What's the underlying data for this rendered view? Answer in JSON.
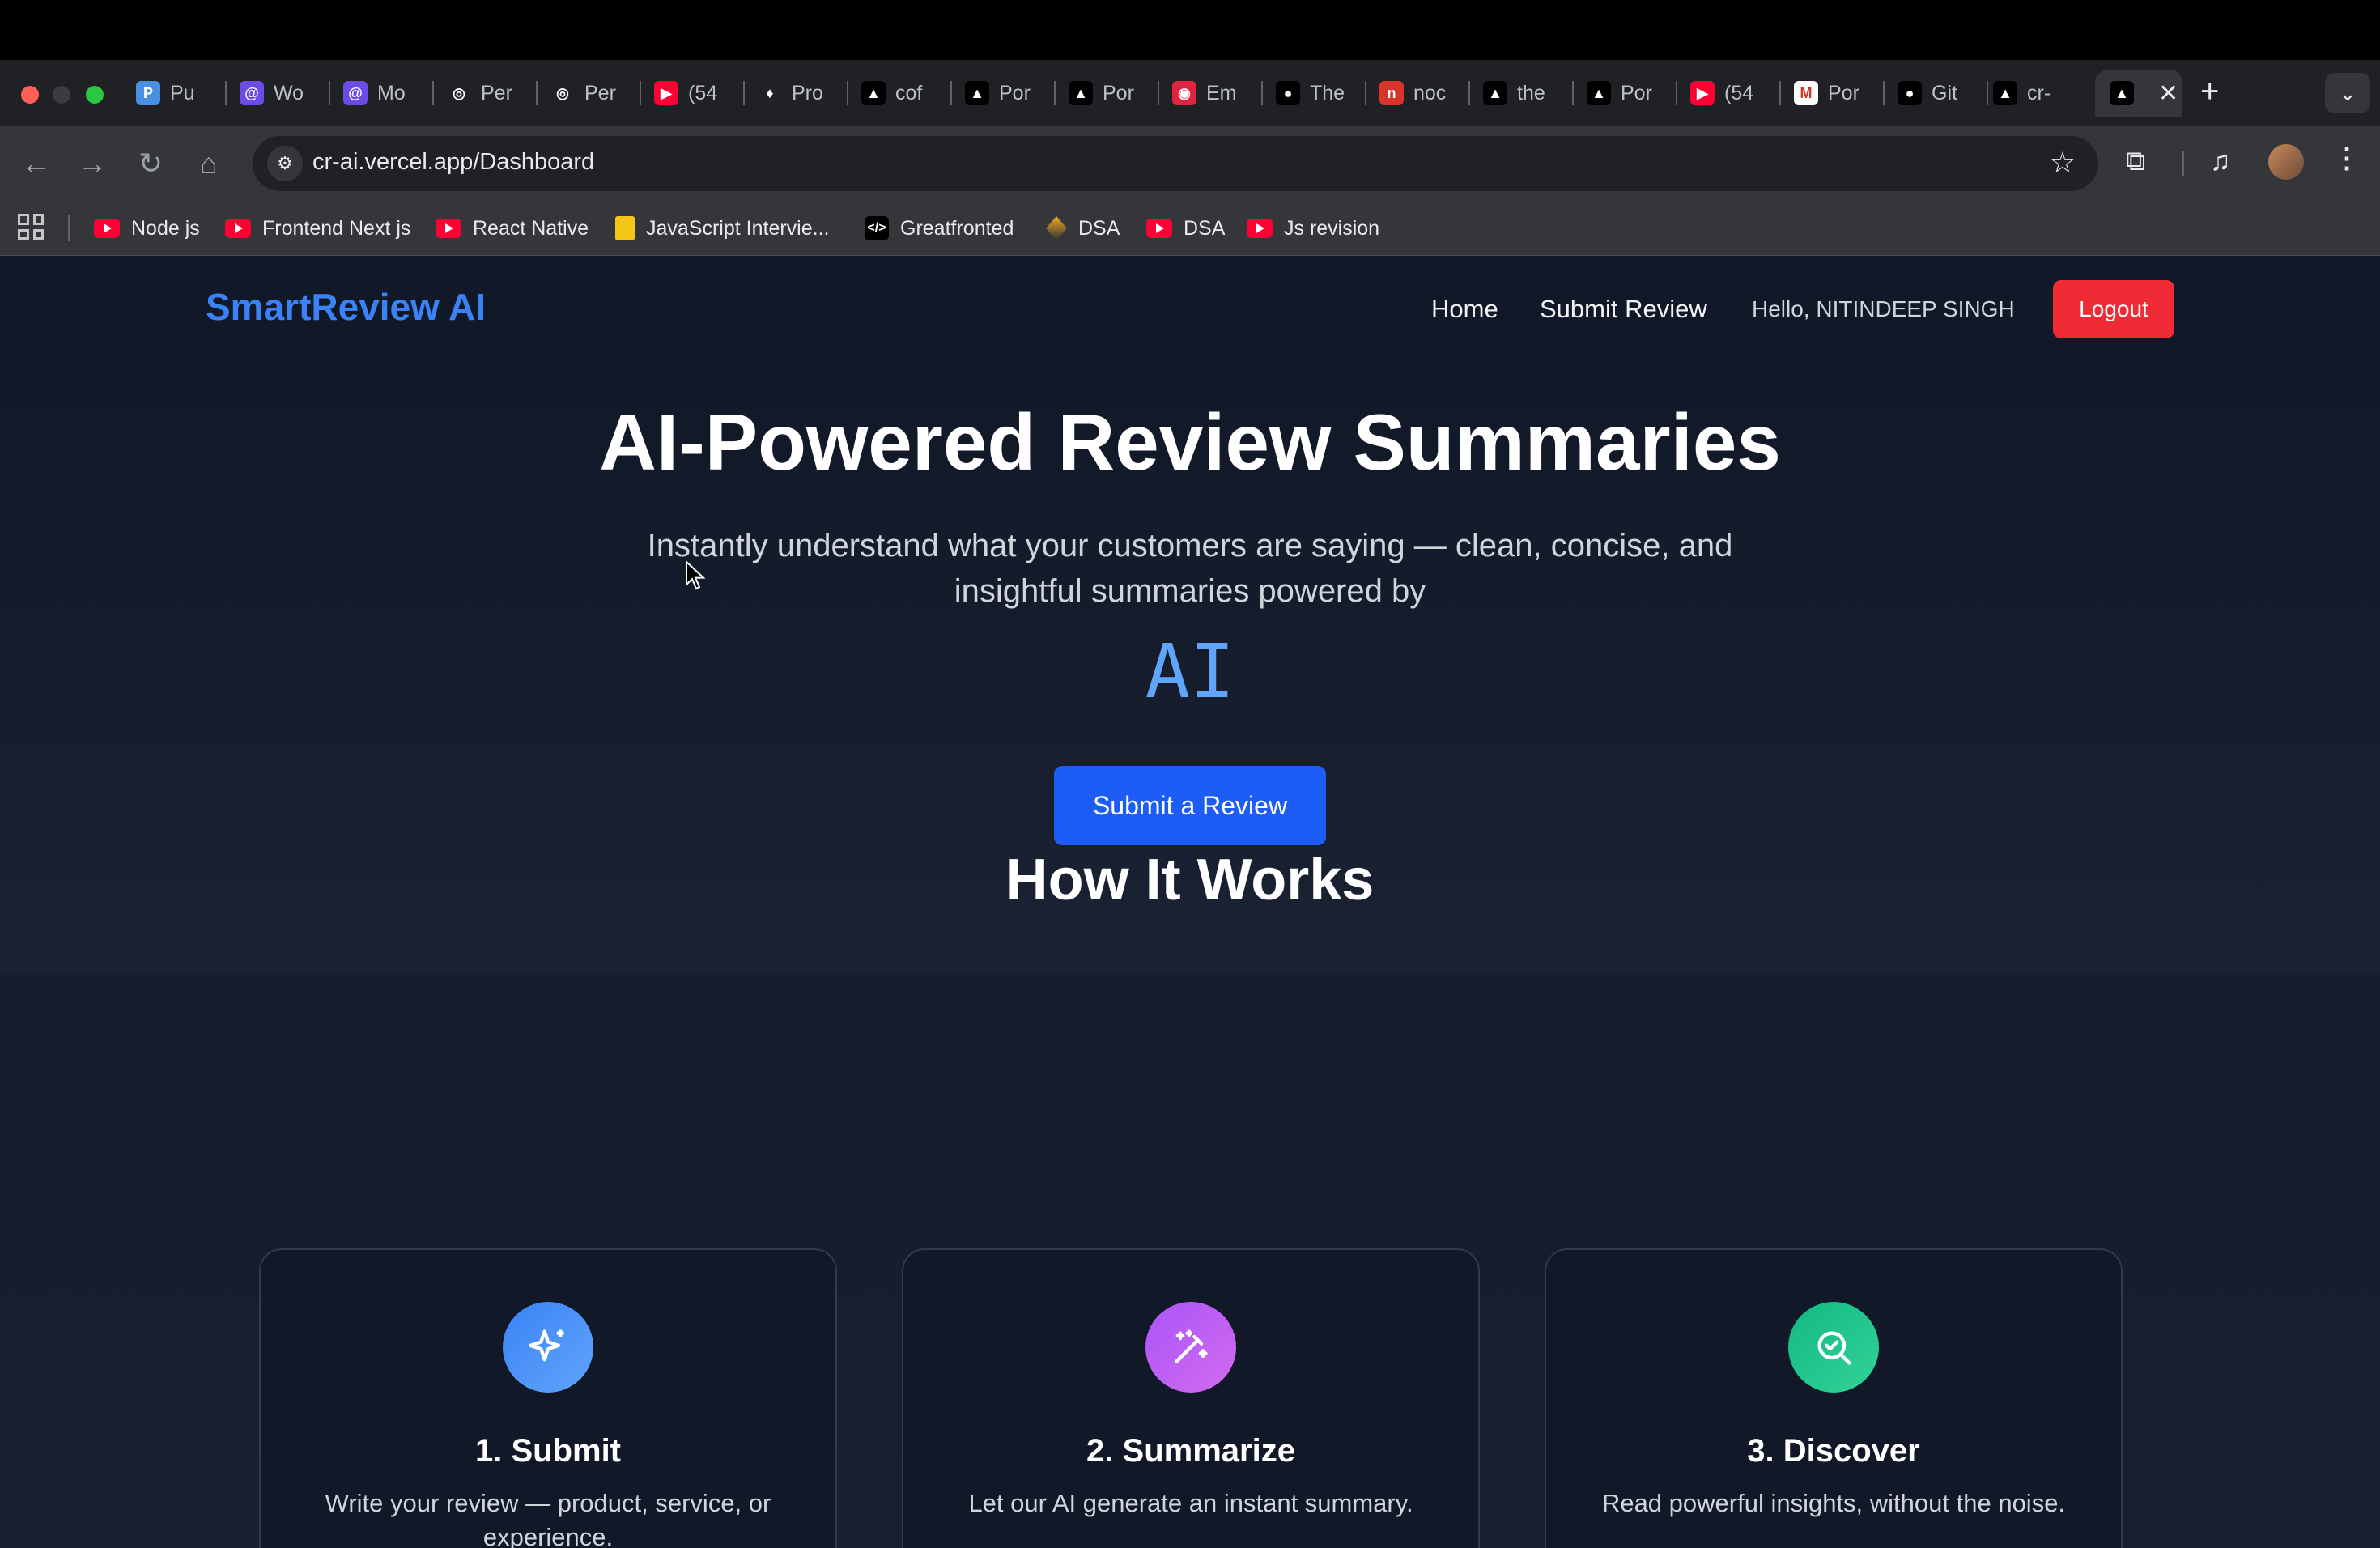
{
  "browser": {
    "tabs": [
      {
        "label": "Pu",
        "fav": "P",
        "color": "#4a90e2"
      },
      {
        "label": "Wo",
        "fav": "@",
        "color": "#6b4ce6"
      },
      {
        "label": "Mo",
        "fav": "@",
        "color": "#6b4ce6"
      },
      {
        "label": "Per",
        "fav": "◎",
        "color": "#202124"
      },
      {
        "label": "Per",
        "fav": "◎",
        "color": "#202124"
      },
      {
        "label": "(54",
        "fav": "▶",
        "color": "#ff0033"
      },
      {
        "label": "Pro",
        "fav": "♦",
        "color": "#202124"
      },
      {
        "label": "cof",
        "fav": "▲",
        "color": "#000000"
      },
      {
        "label": "Por",
        "fav": "▲",
        "color": "#000000"
      },
      {
        "label": "Por",
        "fav": "▲",
        "color": "#000000"
      },
      {
        "label": "Em",
        "fav": "◉",
        "color": "#e02440"
      },
      {
        "label": "The",
        "fav": "●",
        "color": "#000000"
      },
      {
        "label": "noc",
        "fav": "n",
        "color": "#d9342b"
      },
      {
        "label": "the",
        "fav": "▲",
        "color": "#000000"
      },
      {
        "label": "Por",
        "fav": "▲",
        "color": "#000000"
      },
      {
        "label": "(54",
        "fav": "▶",
        "color": "#ff0033"
      },
      {
        "label": "Por",
        "fav": "M",
        "color": "#ffffff"
      },
      {
        "label": "Git",
        "fav": "●",
        "color": "#000000"
      },
      {
        "label": "cr-",
        "fav": "▲",
        "color": "#000000"
      }
    ],
    "active_tab_close": "✕",
    "new_tab": "+",
    "tab_search": "⌄",
    "url": "cr-ai.vercel.app/Dashboard",
    "bookmarks": [
      {
        "label": "Node js",
        "type": "yt"
      },
      {
        "label": "Frontend Next js",
        "type": "yt"
      },
      {
        "label": "React Native",
        "type": "yt"
      },
      {
        "label": "JavaScript Intervie...",
        "type": "note"
      },
      {
        "label": "Greatfronted",
        "type": "gf"
      },
      {
        "label": "DSA",
        "type": "dsa"
      },
      {
        "label": "DSA",
        "type": "yt"
      },
      {
        "label": "Js revision",
        "type": "yt"
      }
    ]
  },
  "app": {
    "brand": "SmartReview AI",
    "nav": {
      "home": "Home",
      "submit": "Submit Review"
    },
    "greeting": "Hello, NITINDEEP SINGH",
    "logout": "Logout",
    "hero": {
      "title": "AI-Powered Review Summaries",
      "subtitle": "Instantly understand what your customers are saying — clean, concise, and insightful summaries powered by",
      "highlight": "AI",
      "cta": "Submit a Review"
    },
    "how": {
      "title": "How It Works",
      "steps": [
        {
          "title": "1. Submit",
          "text": "Write your review — product, service, or experience.",
          "icon": "sparkle-icon"
        },
        {
          "title": "2. Summarize",
          "text": "Let our AI generate an instant summary.",
          "icon": "magic-wand-icon"
        },
        {
          "title": "3. Discover",
          "text": "Read powerful insights, without the noise.",
          "icon": "search-check-icon"
        }
      ]
    }
  },
  "colors": {
    "accent": "#3b82f6",
    "logout": "#ef2b35",
    "cta": "#1d5cf5",
    "page_bg": "#0f172a"
  }
}
